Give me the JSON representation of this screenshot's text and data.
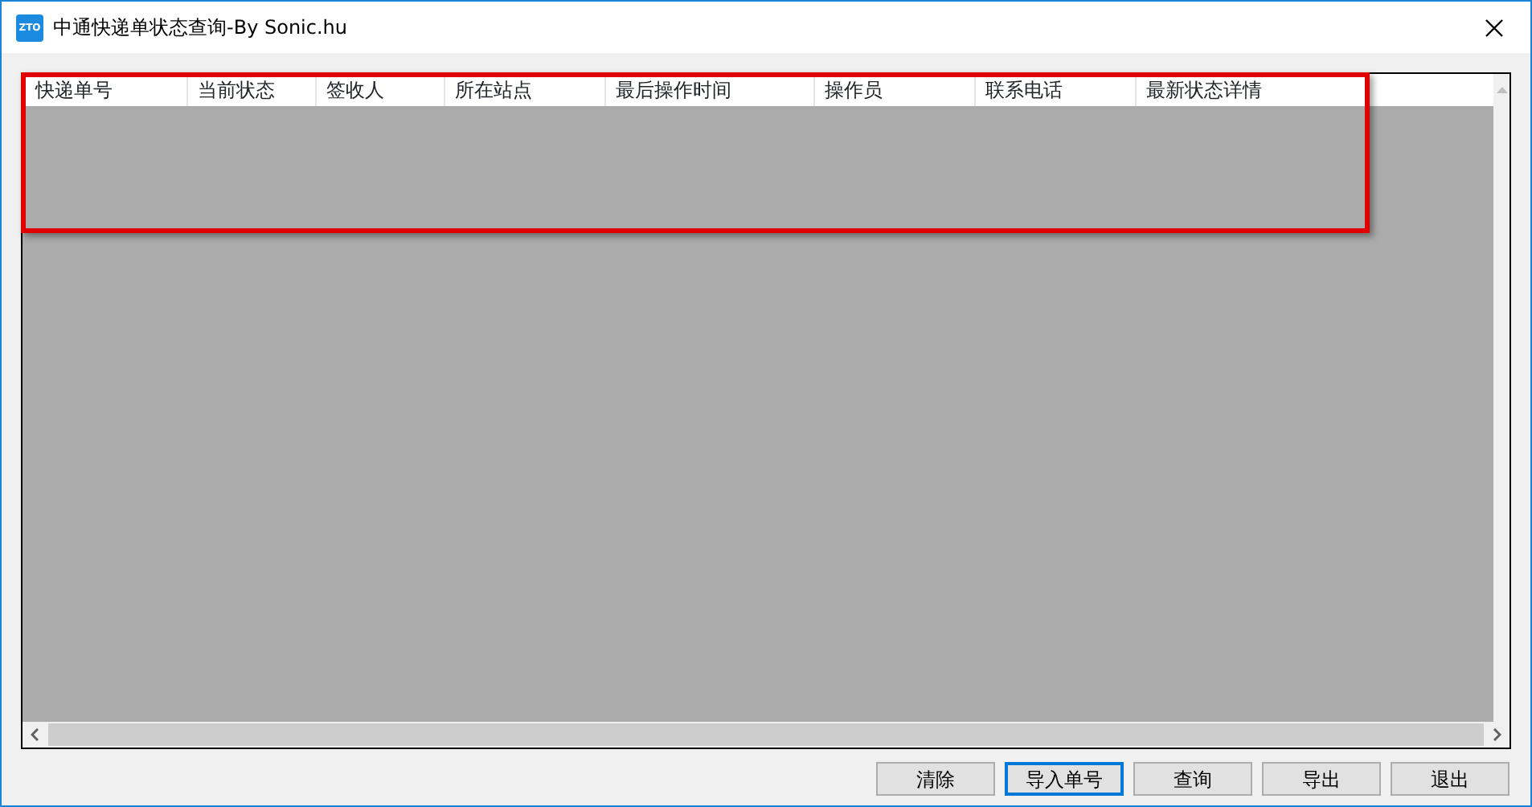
{
  "window": {
    "title": "中通快递单状态查询-By Sonic.hu",
    "logo_text": "ZTO"
  },
  "table": {
    "columns": [
      {
        "label": "快递单号"
      },
      {
        "label": "当前状态"
      },
      {
        "label": "签收人"
      },
      {
        "label": "所在站点"
      },
      {
        "label": "最后操作时间"
      },
      {
        "label": "操作员"
      },
      {
        "label": "联系电话"
      },
      {
        "label": "最新状态详情"
      }
    ]
  },
  "buttons": [
    {
      "label": "清除",
      "focused": false
    },
    {
      "label": "导入单号",
      "focused": true
    },
    {
      "label": "查询",
      "focused": false
    },
    {
      "label": "导出",
      "focused": false
    },
    {
      "label": "退出",
      "focused": false
    }
  ]
}
